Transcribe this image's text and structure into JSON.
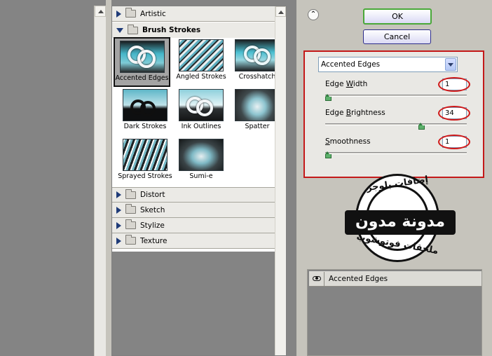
{
  "gallery": {
    "categories_top": [
      {
        "label": "Artistic",
        "expanded": false
      },
      {
        "label": "Brush Strokes",
        "expanded": true
      }
    ],
    "filters": [
      {
        "label": "Accented Edges",
        "selected": true
      },
      {
        "label": "Angled Strokes",
        "selected": false
      },
      {
        "label": "Crosshatch",
        "selected": false
      },
      {
        "label": "Dark Strokes",
        "selected": false
      },
      {
        "label": "Ink Outlines",
        "selected": false
      },
      {
        "label": "Spatter",
        "selected": false
      },
      {
        "label": "Sprayed Strokes",
        "selected": false
      },
      {
        "label": "Sumi-e",
        "selected": false
      }
    ],
    "categories_bottom": [
      {
        "label": "Distort",
        "expanded": false
      },
      {
        "label": "Sketch",
        "expanded": false
      },
      {
        "label": "Stylize",
        "expanded": false
      },
      {
        "label": "Texture",
        "expanded": false
      }
    ]
  },
  "options": {
    "ok_label": "OK",
    "cancel_label": "Cancel",
    "filter_select_value": "Accented Edges",
    "params": [
      {
        "label_pre": "Edge ",
        "label_underline": "W",
        "label_post": "idth",
        "value": "1",
        "slider_fraction": 0.0
      },
      {
        "label_pre": "Edge ",
        "label_underline": "B",
        "label_post": "rightness",
        "value": "34",
        "slider_fraction": 0.68
      },
      {
        "label_pre": "",
        "label_underline": "S",
        "label_post": "moothness",
        "value": "1",
        "slider_fraction": 0.0
      }
    ],
    "layer_label": "Accented Edges"
  },
  "watermark": {
    "banner": "مدونة مدون",
    "top_text": "إضافات بلوجر",
    "bottom_text": "ملحقات فوتوشوب"
  },
  "colors": {
    "highlight_red": "#c41919",
    "ok_border_green": "#49a838",
    "slider_green": "#5cb06b"
  },
  "icons": [
    "chevron-up-icon",
    "folder-icon",
    "expand-triangle-icon",
    "dropdown-arrow-icon",
    "eye-icon"
  ]
}
